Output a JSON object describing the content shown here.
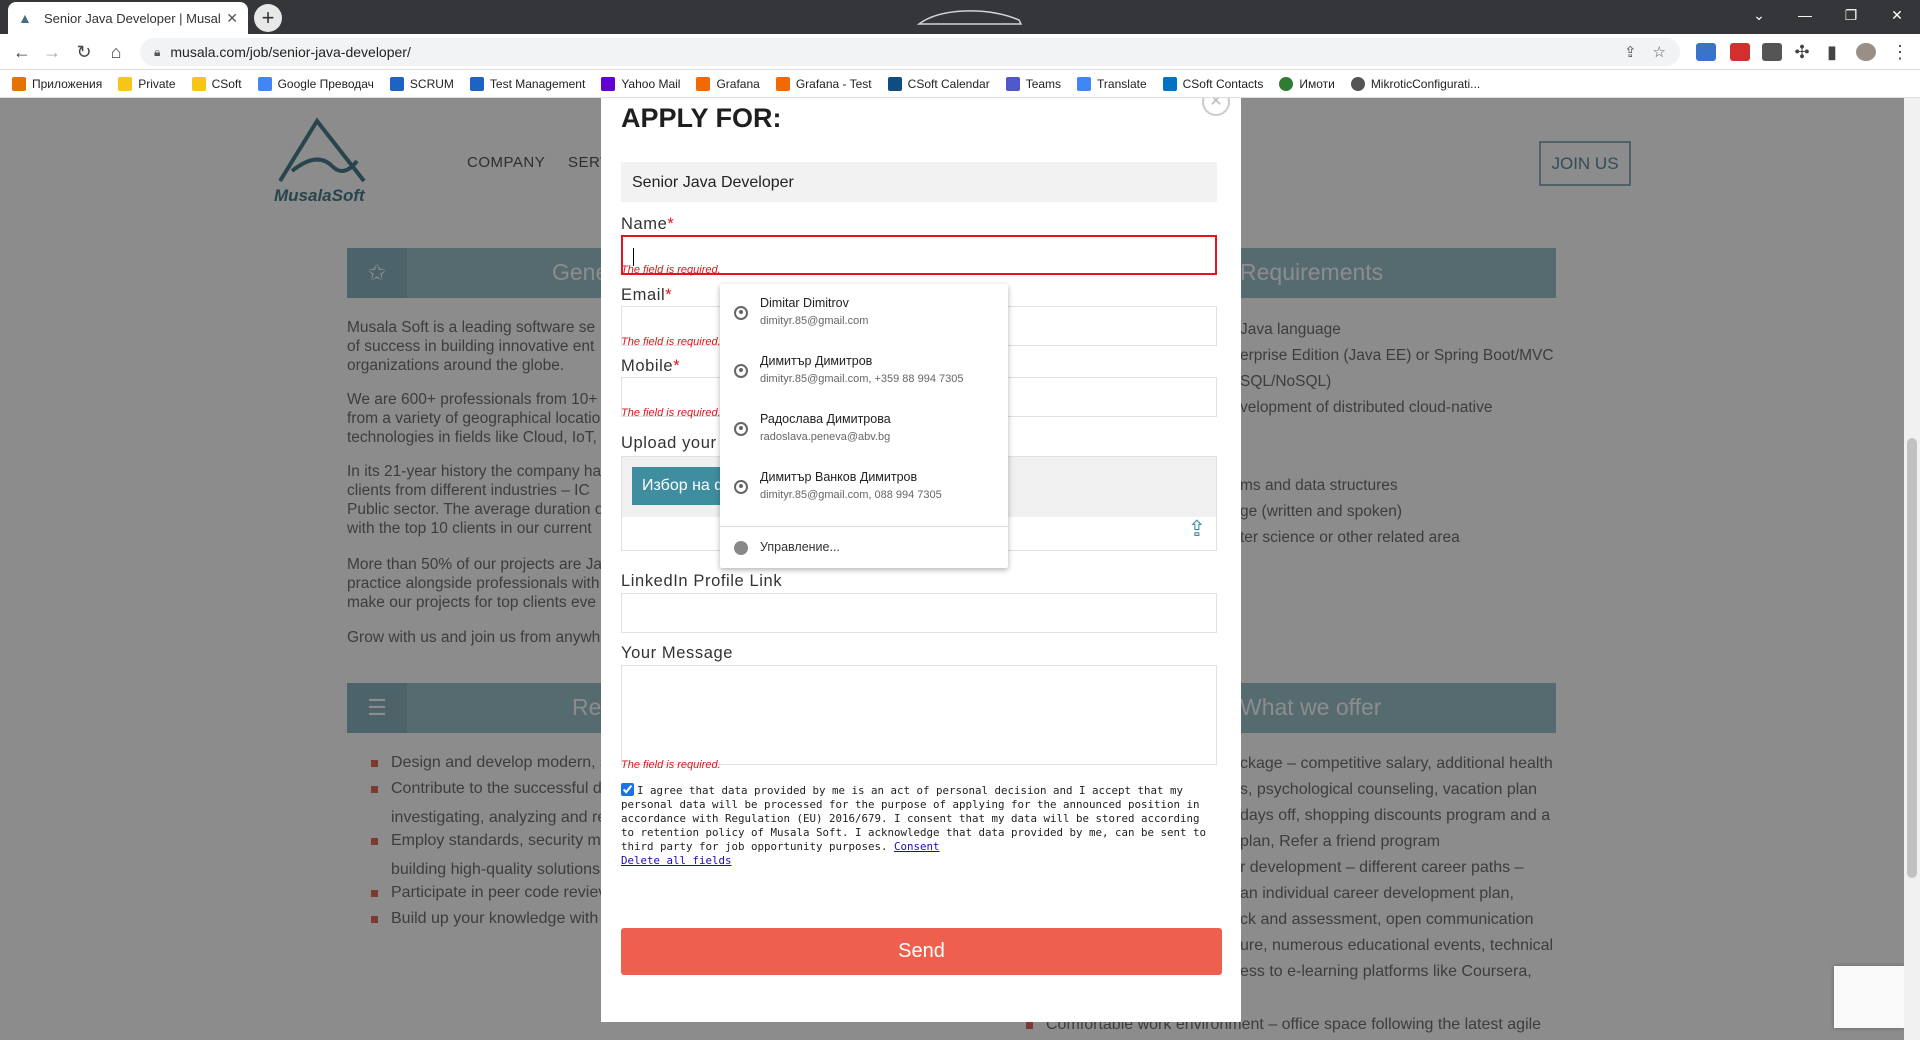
{
  "browser": {
    "tab_title": "Senior Java Developer | Musala S",
    "url": "musala.com/job/senior-java-developer/",
    "bookmarks": [
      "Приложения",
      "Private",
      "CSoft",
      "Google Преводач",
      "SCRUM",
      "Test Management",
      "Yahoo Mail",
      "Grafana",
      "Grafana - Test",
      "CSoft Calendar",
      "Teams",
      "Translate",
      "CSoft Contacts",
      "Имоти",
      "MikroticConfigurati..."
    ]
  },
  "site": {
    "logo_text": "MusalaSoft",
    "nav": [
      "COMPANY",
      "SERV"
    ],
    "join_label": "JOIN US",
    "sections": {
      "general_title": "Gene",
      "requirements_title": "Requirements",
      "responsibilities_title": "Re",
      "offer_title": "What we offer"
    },
    "left_paragraphs": [
      "Musala Soft is a leading software se\nof success in building innovative ent\norganizations around the globe.",
      "We are 600+ professionals from 10+\nfrom a variety of geographical locatio\ntechnologies in fields like Cloud, IoT,",
      "In its 21-year history the company ha\nclients from different industries – IC\nPublic sector. The average duration o\nwith the top 10 clients in our current",
      "More than 50% of our projects are Ja\npractice alongside professionals with\nmake our projects for top clients eve",
      "Grow with us and join us from anywh"
    ],
    "right_requirements": [
      "Java language",
      "erprise Edition (Java EE) or Spring Boot/MVC",
      "SQL/NoSQL)",
      "velopment of distributed cloud-native",
      "ms and data structures",
      "ge (written and spoken)",
      "ter science or other related area"
    ],
    "responsibilities": [
      "Design and develop modern, s",
      "Contribute to the successful d",
      "investigating, analyzing and re",
      "Employ standards, security m",
      "building high-quality solutions",
      "Participate in peer code reviev",
      "Build up your knowledge with"
    ],
    "offer": [
      "ckage – competitive salary, additional health",
      "s, psychological counseling, vacation plan",
      "days off, shopping discounts program and a",
      "plan, Refer a friend program",
      "r development – different career paths –",
      "an individual career development plan,",
      "ck and assessment, open communication",
      "ure, numerous educational events, technical",
      "ess to e-learning platforms like Coursera,",
      "Comfortable work environment – office space following the latest agile"
    ]
  },
  "modal": {
    "title": "APPLY FOR:",
    "position_value": "Senior Java Developer",
    "name_label": "Name",
    "email_label": "Email",
    "mobile_label": "Mobile",
    "required_mark": "*",
    "error_required": "The field is required.",
    "upload_label": "Upload your",
    "upload_button": "Избор на ф",
    "linkedin_label": "LinkedIn Profile Link",
    "message_label": "Your Message",
    "consent_text": "I agree that data provided by me is an act of personal decision and I accept that my personal data will be processed for the purpose of applying for the announced position in accordance with Regulation (EU) 2016/679. I consent that my data will be stored according to retention policy of Musala Soft. I acknowledge that data provided by me, can be sent to third party for job opportunity purposes.",
    "consent_link": "Consent",
    "delete_link": "Delete all fields",
    "send_label": "Send"
  },
  "autofill": {
    "items": [
      {
        "name": "Dimitar Dimitrov",
        "detail": "dimityr.85@gmail.com"
      },
      {
        "name": "Димитър Димитров",
        "detail": "dimityr.85@gmail.com, +359 88 994 7305"
      },
      {
        "name": "Радослава Димитрова",
        "detail": "radoslava.peneva@abv.bg"
      },
      {
        "name": "Димитър Ванков Димитров",
        "detail": "dimityr.85@gmail.com, 088 994 7305"
      }
    ],
    "manage_label": "Управление..."
  }
}
